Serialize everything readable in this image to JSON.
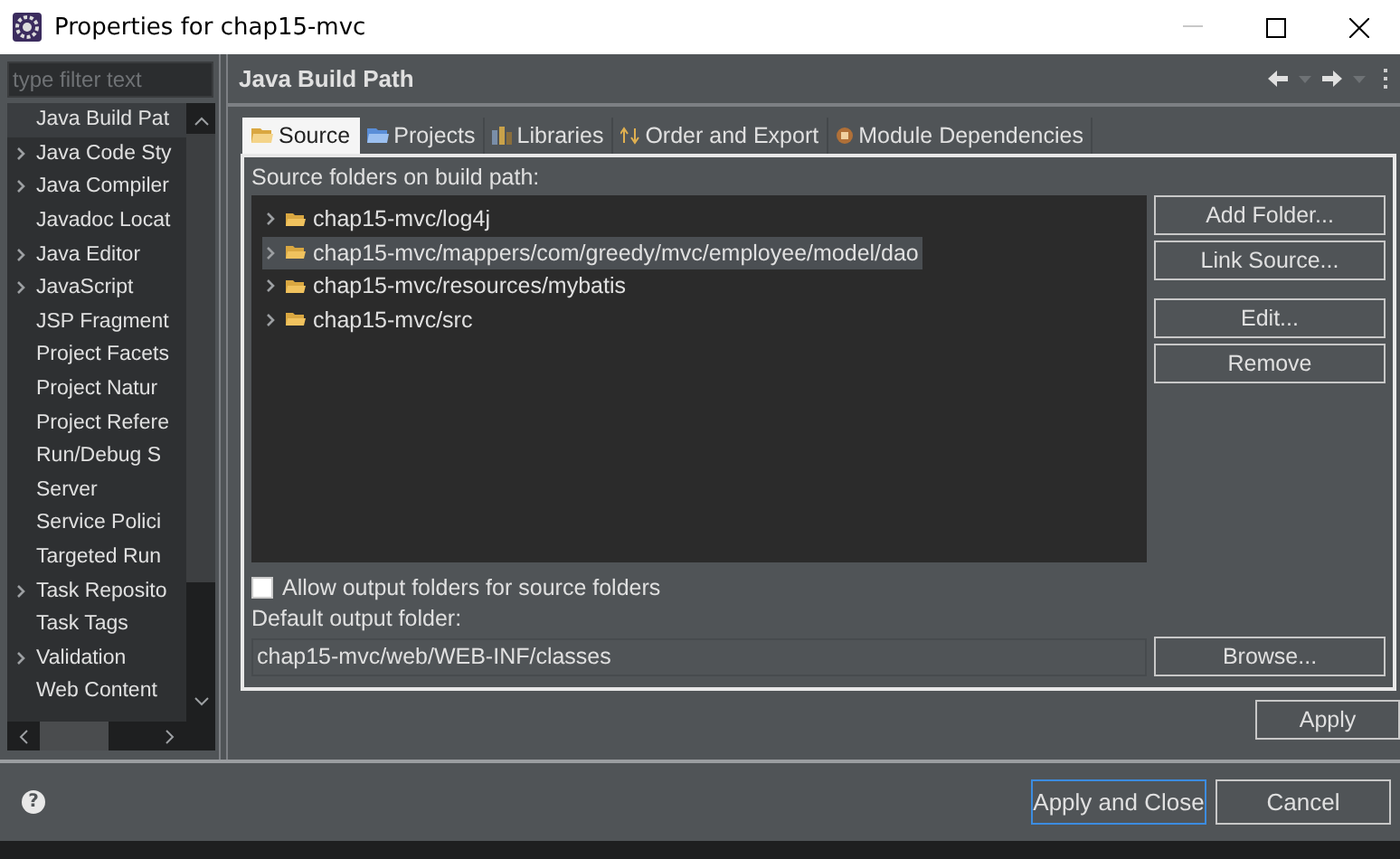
{
  "window": {
    "title": "Properties for chap15-mvc",
    "minimize": {
      "disabled": true
    }
  },
  "sidebar": {
    "filter": {
      "placeholder": "type filter text"
    },
    "items": [
      {
        "label": "Java Build Pat",
        "selected": true
      },
      {
        "label": "Java Code Sty",
        "selected": false,
        "expanded": false
      },
      {
        "label": "Java Compiler",
        "selected": false,
        "expanded": false
      },
      {
        "label": "Javadoc Locat",
        "selected": false
      },
      {
        "label": "Java Editor",
        "selected": false,
        "expanded": false
      },
      {
        "label": "JavaScript",
        "selected": false,
        "expanded": false
      },
      {
        "label": "JSP Fragment",
        "selected": false
      },
      {
        "label": "Project Facets",
        "selected": false
      },
      {
        "label": "Project Natur",
        "selected": false
      },
      {
        "label": "Project Refere",
        "selected": false
      },
      {
        "label": "Run/Debug S",
        "selected": false
      },
      {
        "label": "Server",
        "selected": false
      },
      {
        "label": "Service Polici",
        "selected": false
      },
      {
        "label": "Targeted Run",
        "selected": false
      },
      {
        "label": "Task Reposito",
        "selected": false,
        "expanded": false
      },
      {
        "label": "Task Tags",
        "selected": false
      },
      {
        "label": "Validation",
        "selected": false,
        "expanded": false
      },
      {
        "label": "Web Content",
        "selected": false
      }
    ]
  },
  "page": {
    "title": "Java Build Path",
    "tabs": [
      {
        "label": "Source",
        "selected": true
      },
      {
        "label": "Projects",
        "selected": false
      },
      {
        "label": "Libraries",
        "selected": false
      },
      {
        "label": "Order and Export",
        "selected": false
      },
      {
        "label": "Module Dependencies",
        "selected": false
      }
    ],
    "source_label": "Source folders on build path:",
    "folders": [
      {
        "path": "chap15-mvc/log4j",
        "expanded": false,
        "selected": false
      },
      {
        "path": "chap15-mvc/mappers/com/greedy/mvc/employee/model/dao",
        "expanded": false,
        "selected": true
      },
      {
        "path": "chap15-mvc/resources/mybatis",
        "expanded": false,
        "selected": false
      },
      {
        "path": "chap15-mvc/src",
        "expanded": false,
        "selected": false
      }
    ],
    "side_buttons": [
      "Add Folder...",
      "Link Source...",
      "Edit...",
      "Remove"
    ],
    "allow_output": {
      "label": "Allow output folders for source folders",
      "checked": false
    },
    "output_label": "Default output folder:",
    "output_field": {
      "value": "chap15-mvc/web/WEB-INF/classes"
    },
    "browse_button": "Browse...",
    "apply_button": "Apply"
  },
  "footer": {
    "help": "?",
    "buttons": [
      {
        "label": "Apply and Close",
        "default": true
      },
      {
        "label": "Cancel",
        "default": false
      }
    ]
  }
}
